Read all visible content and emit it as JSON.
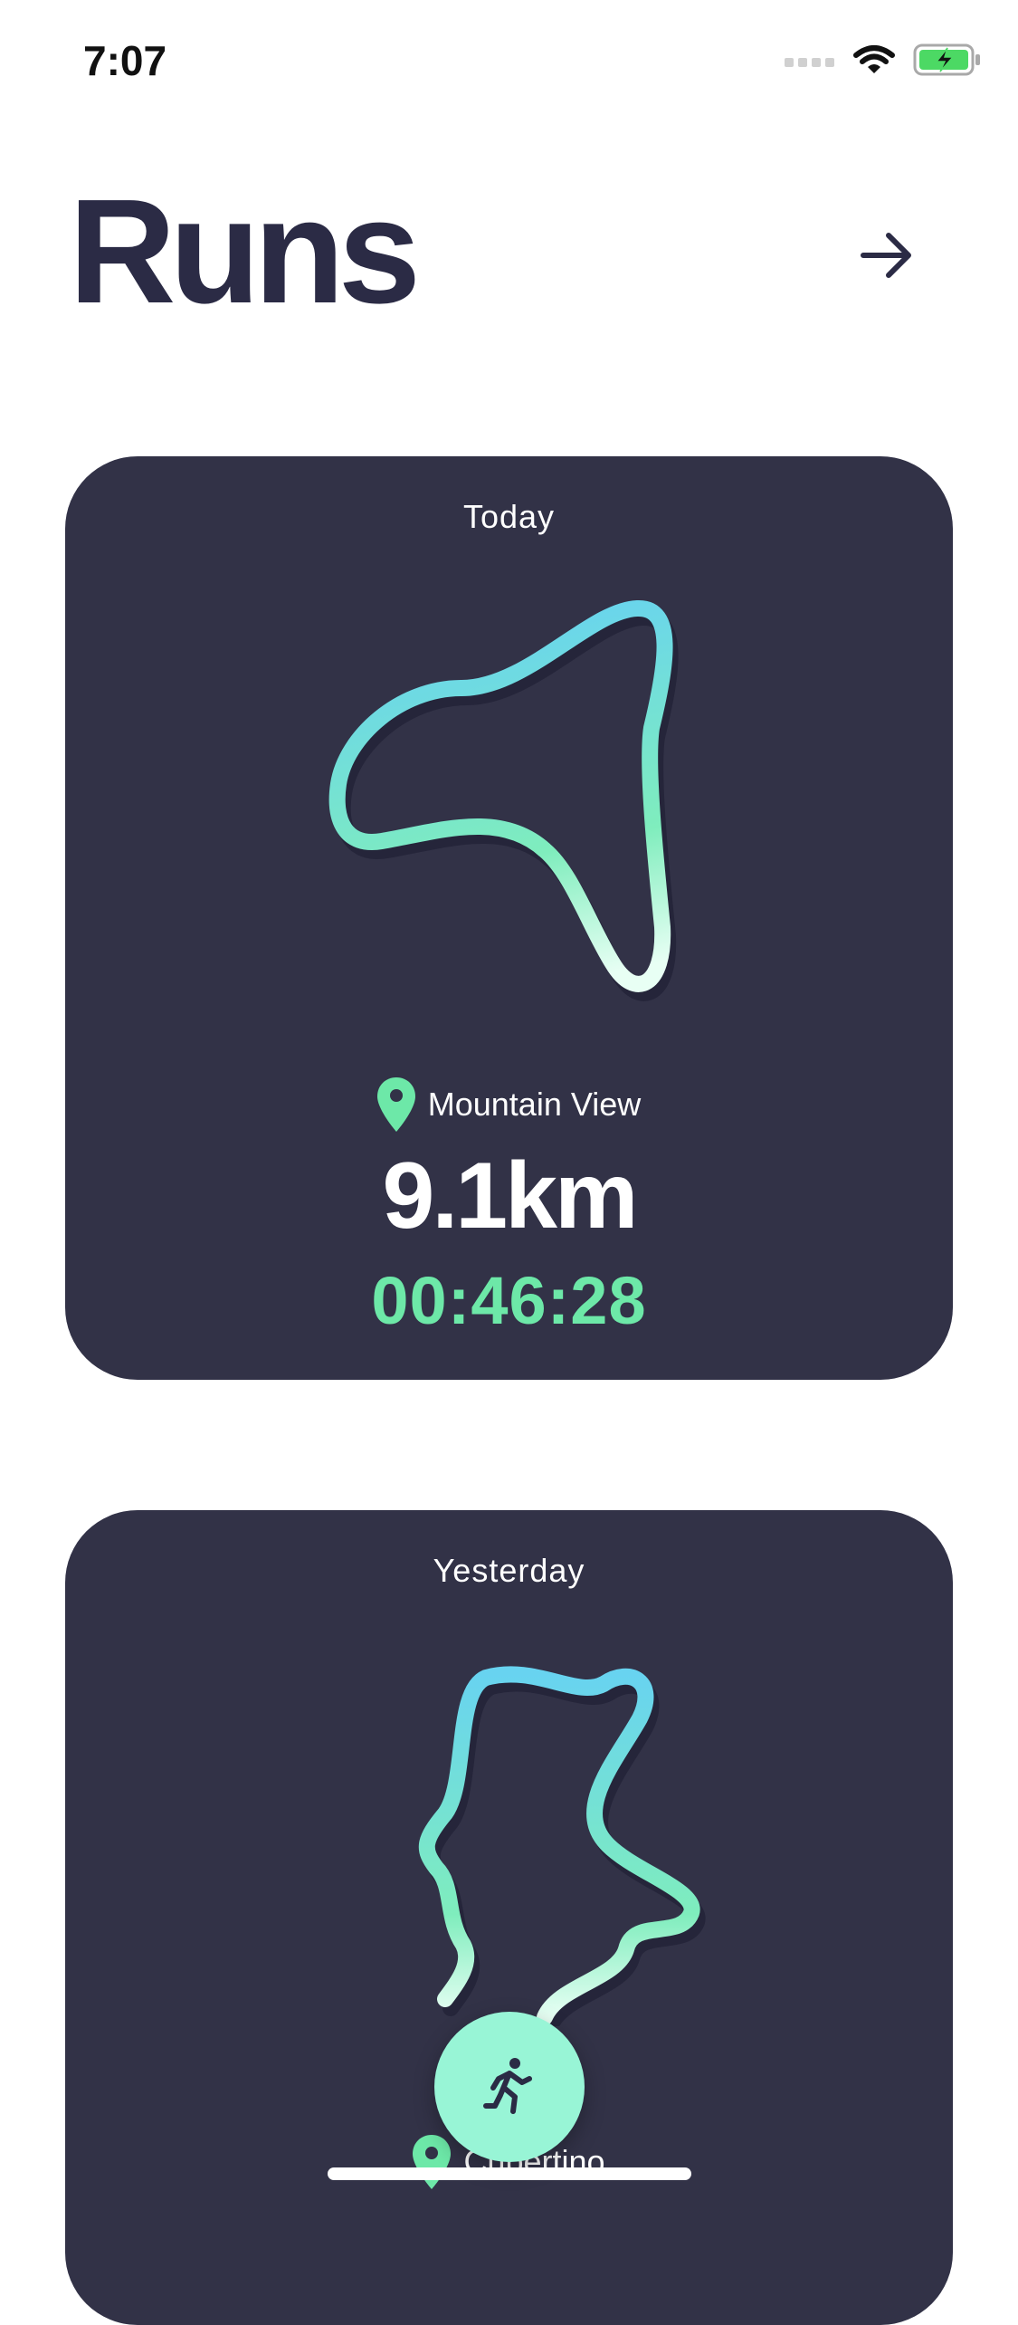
{
  "status_bar": {
    "time": "7:07"
  },
  "header": {
    "title": "Runs"
  },
  "runs": [
    {
      "day": "Today",
      "location": "Mountain View",
      "distance": "9.1km",
      "duration": "00:46:28"
    },
    {
      "day": "Yesterday",
      "location": "Cupertino"
    }
  ],
  "icons": {
    "header_action": "arrow-right-icon",
    "location": "map-pin-icon",
    "start_run": "running-person-icon"
  },
  "colors": {
    "card_background": "#323247",
    "accent_green": "#6de8a8",
    "route_gradient_start": "#68d3f0",
    "route_gradient_end": "#e8fff4",
    "fab_background": "#98f5d6",
    "title_text": "#2b2b45"
  }
}
